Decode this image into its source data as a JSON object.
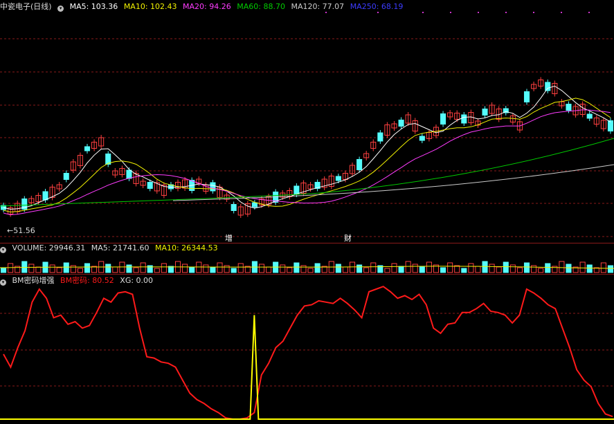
{
  "price_header": {
    "title": "中瓷电子(日线)",
    "ma5": "MA5: 103.36",
    "ma10": "MA10: 102.43",
    "ma20": "MA20: 94.26",
    "ma60": "MA60: 88.70",
    "ma120": "MA120: 77.07",
    "ma250": "MA250: 68.19"
  },
  "volume_header": {
    "title": "VOLUME: 29946.31",
    "ma5": "MA5: 21741.60",
    "ma10": "MA10: 26344.53"
  },
  "indicator_header": {
    "title": "BM密码增强",
    "bm": "BM密码: 80.52",
    "xg": "XG: 0.00"
  },
  "price_low_label": "51.56",
  "event_markers": {
    "zeng": "增",
    "cai": "财"
  },
  "colors": {
    "ma5": "#ffffff",
    "ma10": "#f2f200",
    "ma20": "#ff3cff",
    "ma60": "#00cc00",
    "ma120": "#cccccc",
    "ma250": "#3c3cff",
    "up": "#ff4040",
    "down": "#54fcfc",
    "bm": "#ff1a1a",
    "xg": "#ffff00",
    "grid": "#8a1a1a"
  },
  "chart_data": {
    "type": "candlestick",
    "indicator_series": {
      "name": "BM密码",
      "values": [
        50,
        40,
        55,
        68,
        90,
        100,
        93,
        78,
        80,
        73,
        75,
        70,
        72,
        82,
        93,
        90,
        97,
        98,
        96,
        70,
        48,
        47,
        44,
        43,
        40,
        30,
        20,
        15,
        12,
        8,
        5,
        1,
        0,
        0,
        1,
        5,
        34,
        43,
        55,
        60,
        70,
        80,
        87,
        88,
        91,
        90,
        89,
        93,
        89,
        84,
        78,
        98,
        100,
        102,
        98,
        93,
        95,
        92,
        96,
        88,
        70,
        66,
        73,
        74,
        82,
        82,
        85,
        89,
        83,
        82,
        80,
        74,
        80,
        100,
        97,
        93,
        88,
        85,
        70,
        55,
        38,
        30,
        25,
        12,
        4,
        2
      ]
    },
    "xg_series": {
      "name": "XG",
      "pulse_index": 35,
      "value_on": 100,
      "value_off": 0
    }
  }
}
